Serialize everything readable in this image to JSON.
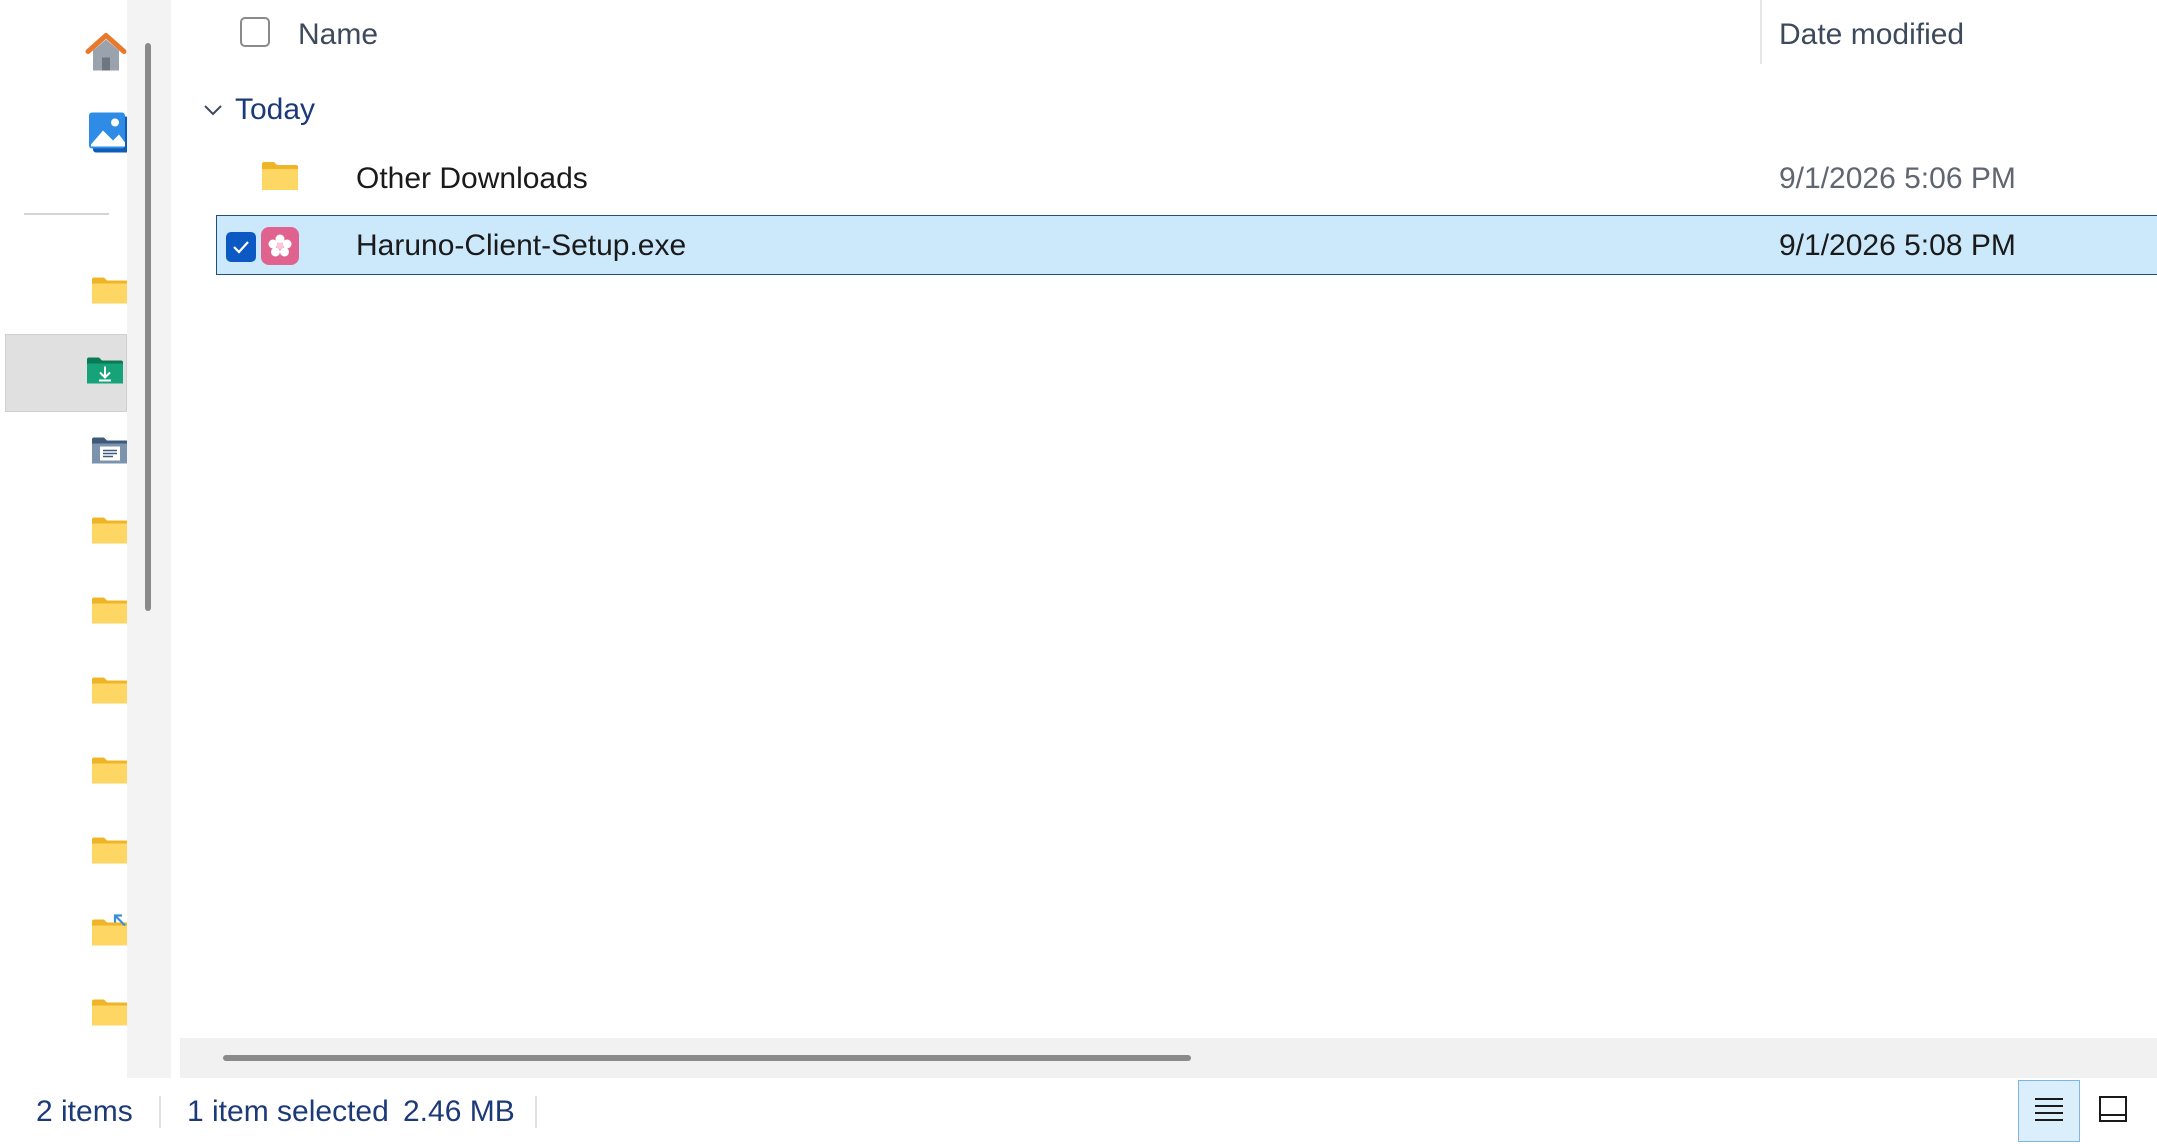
{
  "nav": {
    "items": [
      {
        "name": "home-icon"
      },
      {
        "name": "gallery-icon"
      },
      {
        "name": "folder-icon"
      },
      {
        "name": "downloads-folder-icon",
        "active": true
      },
      {
        "name": "documents-folder-icon"
      },
      {
        "name": "folder-icon"
      },
      {
        "name": "folder-icon"
      },
      {
        "name": "folder-icon"
      },
      {
        "name": "folder-icon"
      },
      {
        "name": "folder-icon"
      },
      {
        "name": "shortcut-folder-icon"
      },
      {
        "name": "folder-icon"
      }
    ]
  },
  "header": {
    "name_label": "Name",
    "date_label": "Date modified"
  },
  "group": {
    "label": "Today"
  },
  "files": [
    {
      "name": "Other Downloads",
      "date": "9/1/2026 5:06 PM",
      "type": "folder",
      "selected": false
    },
    {
      "name": "Haruno-Client-Setup.exe",
      "date": "9/1/2026 5:08 PM",
      "type": "exe",
      "selected": true
    }
  ],
  "status": {
    "item_count": "2 items",
    "selection": "1 item selected",
    "size": "2.46 MB"
  },
  "colors": {
    "selection_bg": "#cce8fb",
    "checkbox_accent": "#0c59c3",
    "group_text": "#1c3a78"
  }
}
